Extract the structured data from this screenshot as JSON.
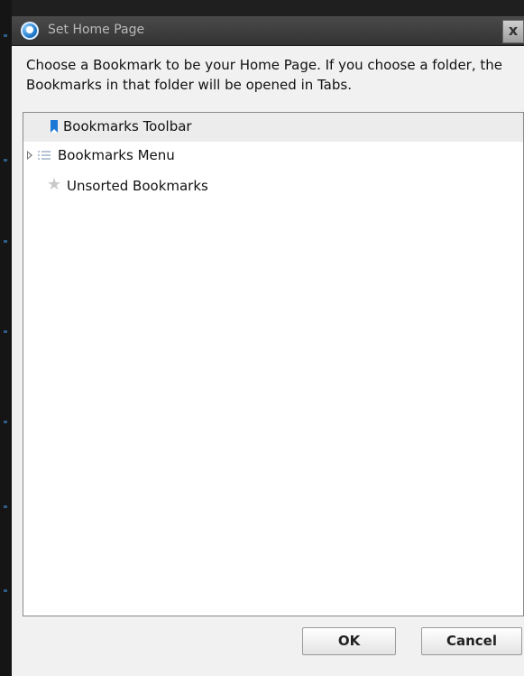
{
  "window": {
    "title": "Set Home Page",
    "close_label": "x"
  },
  "dialog": {
    "prompt": "Choose a Bookmark to be your Home Page. If you choose a folder, the Bookmarks in that folder will be opened in Tabs."
  },
  "tree": {
    "items": [
      {
        "label": "Bookmarks Toolbar",
        "icon": "bookmark-ribbon-icon",
        "selected": true,
        "expandable": false
      },
      {
        "label": "Bookmarks Menu",
        "icon": "menu-list-icon",
        "selected": false,
        "expandable": true
      },
      {
        "label": "Unsorted Bookmarks",
        "icon": "star-icon",
        "selected": false,
        "expandable": false
      }
    ]
  },
  "buttons": {
    "ok_label": "OK",
    "cancel_label": "Cancel"
  },
  "colors": {
    "bookmark_blue": "#1c78d6",
    "selection_bg": "#ececec",
    "dialog_bg": "#f1f1f1",
    "titlebar_text": "#b9b9b9"
  }
}
